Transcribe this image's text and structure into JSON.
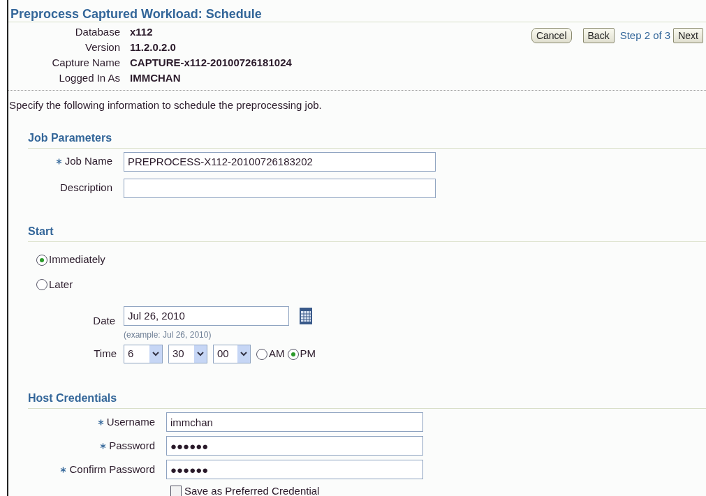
{
  "title": "Preprocess Captured Workload: Schedule",
  "info": [
    {
      "label": "Database",
      "value": "x112"
    },
    {
      "label": "Version",
      "value": "11.2.0.2.0"
    },
    {
      "label": "Capture Name",
      "value": "CAPTURE-x112-20100726181024"
    },
    {
      "label": "Logged In As",
      "value": "IMMCHAN"
    }
  ],
  "nav": {
    "cancel": "Cancel",
    "back": "Back",
    "step": "Step 2 of 3",
    "next": "Next"
  },
  "instructions": "Specify the following information to schedule the preprocessing job.",
  "job_parameters": {
    "heading": "Job Parameters",
    "fields": [
      {
        "label": "Job Name",
        "required": true,
        "value": "PREPROCESS-X112-20100726183202"
      },
      {
        "label": "Description",
        "required": false
      }
    ]
  },
  "start": {
    "heading": "Start",
    "options": [
      {
        "label": "Immediately",
        "selected": true
      },
      {
        "label": "Later",
        "selected": false
      }
    ],
    "date": {
      "label": "Date",
      "value": "Jul 26, 2010",
      "hint": "(example: Jul 26, 2010)"
    },
    "time": {
      "label": "Time",
      "hour": "6",
      "minute": "30",
      "second": "00",
      "periods": [
        {
          "label": "AM",
          "selected": false
        },
        {
          "label": "PM",
          "selected": true
        }
      ]
    }
  },
  "host_credentials": {
    "heading": "Host Credentials",
    "fields": [
      {
        "label": "Username",
        "required": true,
        "value": "immchan"
      },
      {
        "label": "Password",
        "required": true,
        "value": "●●●●●●"
      },
      {
        "label": "Confirm Password",
        "required": true,
        "value": "●●●●●●"
      }
    ],
    "save_preferred": {
      "label": "Save as Preferred Credential",
      "checked": false
    }
  }
}
